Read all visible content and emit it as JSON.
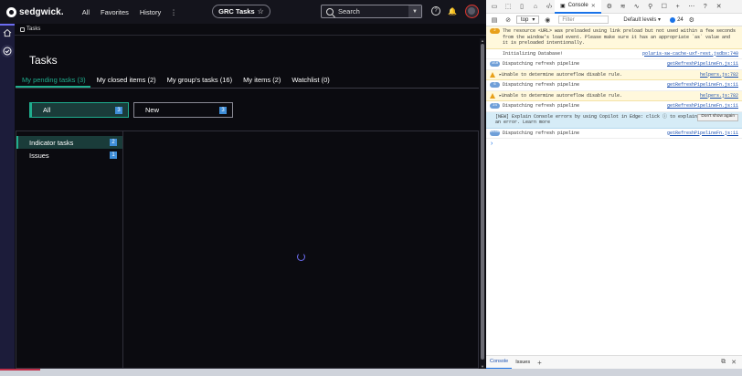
{
  "app": {
    "brand": "sedgwick.",
    "nav": [
      "All",
      "Favorites",
      "History",
      "⋮"
    ],
    "app_chip": "GRC Tasks",
    "search_label": "Search",
    "breadcrumb": "Tasks"
  },
  "page": {
    "title": "Tasks",
    "tabs": [
      "My pending tasks (3)",
      "My closed items (2)",
      "My group's tasks (16)",
      "My items (2)",
      "Watchlist (0)"
    ],
    "filters": [
      {
        "label": "All",
        "count": "3"
      },
      {
        "label": "New",
        "count": "3"
      }
    ],
    "panel_items": [
      {
        "label": "Indicator tasks",
        "count": "2"
      },
      {
        "label": "Issues",
        "count": "1"
      }
    ]
  },
  "devtools": {
    "tab_console": "Console",
    "context": "top",
    "filter_placeholder": "Filter",
    "levels": "Default levels ▾",
    "issues_count": "24",
    "messages": [
      {
        "kind": "warn",
        "count": "2",
        "text": "The resource <URL> was preloaded using link preload but not used within a few seconds from the window's load event. Please make sure it has an appropriate `as` value and it is preloaded intentionally.",
        "src": ""
      },
      {
        "kind": "plain",
        "count": "",
        "text": "Initializing Database!",
        "src": "polaris-sw-cache-uxf-rest.jsdbx:740"
      },
      {
        "kind": "plain",
        "count": "150",
        "text": "Dispatching refresh pipeline",
        "src": "getRefreshPipelineFn.js:11"
      },
      {
        "kind": "warn",
        "count": "",
        "text": "▸Unable to determine autoreflow disable rule.",
        "src": "helpers.js:782"
      },
      {
        "kind": "plain",
        "count": "6",
        "text": "Dispatching refresh pipeline",
        "src": "getRefreshPipelineFn.js:11"
      },
      {
        "kind": "warn",
        "count": "",
        "text": "▸Unable to determine autoreflow disable rule.",
        "src": "helpers.js:782"
      },
      {
        "kind": "plain",
        "count": "24",
        "text": "Dispatching refresh pipeline",
        "src": "getRefreshPipelineFn.js:11"
      },
      {
        "kind": "info",
        "count": "",
        "text": "[NEW] Explain Console errors by using Copilot in Edge: click ⓘ to explain an error. Learn more",
        "src": "",
        "button": "Don't show again"
      },
      {
        "kind": "plain",
        "count": "2686",
        "text": "Dispatching refresh pipeline",
        "src": "getRefreshPipelineFn.js:11"
      }
    ],
    "bottom_tabs": [
      "Console",
      "Issues"
    ]
  }
}
